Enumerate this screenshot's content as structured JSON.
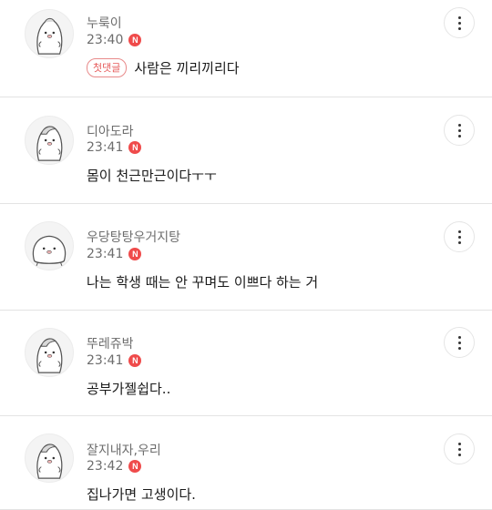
{
  "comments": [
    {
      "nickname": "누룩이",
      "time": "23:40",
      "new_badge": "N",
      "first_badge": "첫댓글",
      "text": "사람은 끼리끼리다"
    },
    {
      "nickname": "디아도라",
      "time": "23:41",
      "new_badge": "N",
      "text": "몸이 천근만근이다ㅜㅜ"
    },
    {
      "nickname": "우당탕탕우거지탕",
      "time": "23:41",
      "new_badge": "N",
      "text": "나는 학생 때는 안 꾸며도 이쁘다 하는 거"
    },
    {
      "nickname": "뚜레쥬박",
      "time": "23:41",
      "new_badge": "N",
      "text": "공부가젤쉽다.."
    },
    {
      "nickname": "잘지내자,우리",
      "time": "23:42",
      "new_badge": "N",
      "text": "집나가면 고생이다."
    }
  ],
  "icons": {
    "avatar": "bird-character-avatar",
    "more": "more-vertical-icon"
  },
  "colors": {
    "new_badge": "#ef4b4b",
    "first_badge": "#e65a5a",
    "meta_text": "#6d6d6d",
    "divider": "#e3e3e3"
  }
}
